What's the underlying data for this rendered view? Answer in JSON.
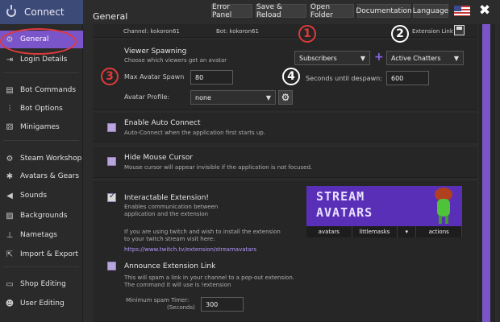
{
  "sidebar": {
    "connect_label": "Connect",
    "items": [
      {
        "label": "General",
        "icon": "gear-icon",
        "glyph": "⚙"
      },
      {
        "label": "Login Details",
        "icon": "login-icon",
        "glyph": "⇥"
      },
      {
        "label": "Bot Commands",
        "icon": "commands-icon",
        "glyph": "▤"
      },
      {
        "label": "Bot Options",
        "icon": "sliders-icon",
        "glyph": "⫶"
      },
      {
        "label": "Minigames",
        "icon": "dice-icon",
        "glyph": "⚄"
      },
      {
        "label": "Steam Workshop",
        "icon": "steam-icon",
        "glyph": "⚙"
      },
      {
        "label": "Avatars & Gears",
        "icon": "avatar-icon",
        "glyph": "✱"
      },
      {
        "label": "Sounds",
        "icon": "speaker-icon",
        "glyph": "◀"
      },
      {
        "label": "Backgrounds",
        "icon": "image-icon",
        "glyph": "▨"
      },
      {
        "label": "Nametags",
        "icon": "nametag-icon",
        "glyph": "⊥"
      },
      {
        "label": "Import & Export",
        "icon": "export-icon",
        "glyph": "⇱"
      },
      {
        "label": "Shop Editing",
        "icon": "shop-icon",
        "glyph": "▭"
      },
      {
        "label": "User Editing",
        "icon": "user-icon",
        "glyph": "☻"
      }
    ]
  },
  "header": {
    "title": "General",
    "buttons": [
      "Error Panel",
      "Save & Reload",
      "Open Folder",
      "Documentation",
      "Language"
    ],
    "close_glyph": "✖"
  },
  "info_bar": {
    "channel": "Channel: kokoron61",
    "bot": "Bot: kokoron61",
    "extension_link": "Extension Link"
  },
  "viewer_spawning": {
    "title": "Viewer Spawning",
    "subtitle": "Choose which viewers get an avatar",
    "select_1": "Subscribers",
    "plus": "+",
    "select_2": "Active Chatters",
    "max_spawn_label": "Max Avatar Spawn",
    "max_spawn_value": "80",
    "despawn_label": "Seconds until despawn:",
    "despawn_value": "600",
    "profile_label": "Avatar Profile:",
    "profile_value": "none"
  },
  "auto_connect": {
    "title": "Enable Auto Connect",
    "desc": "Auto-Connect when the application first starts up.",
    "checked": false
  },
  "hide_cursor": {
    "title": "Hide Mouse Cursor",
    "desc": "Mouse cursor will appear invisible if the application is not focused.",
    "checked": false
  },
  "extension": {
    "title": "Interactable Extension!",
    "desc_1": "Enables communication between",
    "desc_2": "application and the extension",
    "info_1": "If you are using twitch and wish to install the extension",
    "info_2": "to your twitch stream visit here:",
    "link": "https://www.twitch.tv/extension/streamavatars",
    "checked": true,
    "banner_line_1": "STREAM",
    "banner_line_2": "AVATARS",
    "tabs": [
      "avatars",
      "littlemasks",
      "▾",
      "actions"
    ]
  },
  "announce": {
    "title": "Announce Extension Link",
    "desc_1": "This will spam a link in your channel to a pop-out extension.",
    "desc_2": "The command it will use is !extension",
    "timer_label_1": "Minimum spam Timer:",
    "timer_label_2": "(Seconds)",
    "timer_value": "300",
    "checked": false
  },
  "annotations": [
    "1",
    "2",
    "3",
    "4"
  ],
  "colors": {
    "accent": "#7a54c9",
    "annotation_red": "#e03a3a"
  }
}
